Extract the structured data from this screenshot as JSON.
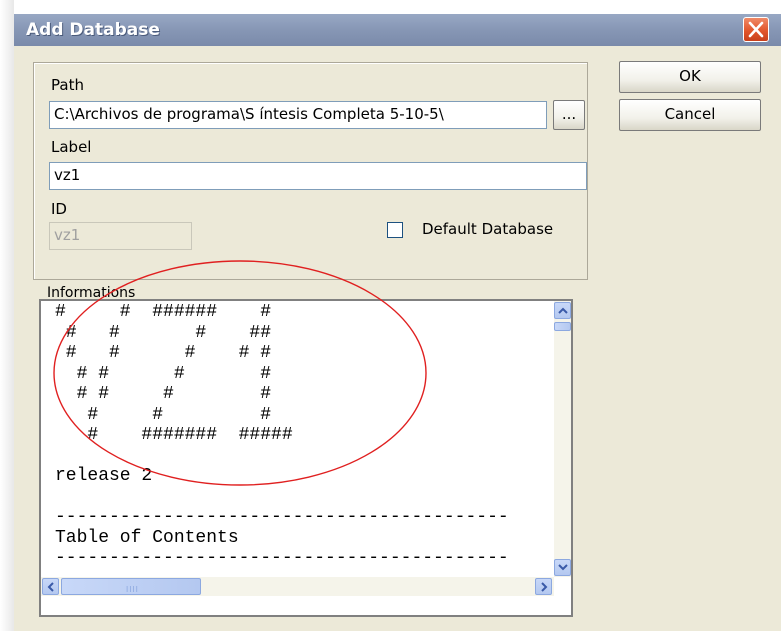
{
  "dialog": {
    "title": "Add Database",
    "close_icon": "close-icon"
  },
  "fields": {
    "path_label": "Path",
    "path_value": "C:\\Archivos de programa\\S íntesis Completa 5-10-5\\",
    "browse_label": "...",
    "label_label": "Label",
    "label_value": "vz1",
    "id_label": "ID",
    "id_value": "vz1",
    "default_db_label": "Default Database",
    "default_db_checked": false
  },
  "buttons": {
    "ok": "OK",
    "cancel": "Cancel"
  },
  "informations": {
    "label": "Informations",
    "content": "#     #  ######    #\n #   #       #    ##\n #   #      #    # #\n  # #      #       #\n  # #     #        #\n   #     #         #\n   #    #######  #####\n\nrelease 2\n\n------------------------------------------\nTable of Contents\n------------------------------------------"
  },
  "scrollbars": {
    "up_icon": "scroll-up-icon",
    "down_icon": "scroll-down-icon",
    "left_icon": "scroll-left-icon",
    "right_icon": "scroll-right-icon"
  },
  "colors": {
    "titlebar": "#8898b6",
    "close_button": "#e2562c",
    "annotation_circle": "#e02020",
    "dialog_bg": "#ece9d8"
  }
}
